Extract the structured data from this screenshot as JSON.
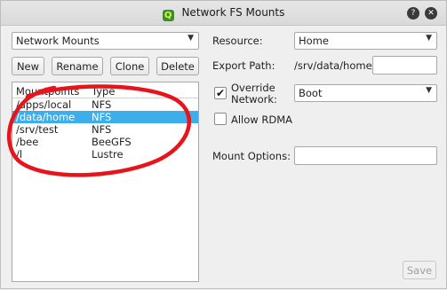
{
  "window": {
    "title": "Network FS Mounts",
    "app_icon_glyph": "Q",
    "help_glyph": "?",
    "close_glyph": "✕"
  },
  "mount_selector": {
    "value": "Network Mounts"
  },
  "toolbar": {
    "new_label": "New",
    "rename_label": "Rename",
    "clone_label": "Clone",
    "delete_label": "Delete"
  },
  "list": {
    "columns": [
      "Mountpoints",
      "Type"
    ],
    "rows": [
      {
        "mountpoint": "/apps/local",
        "type": "NFS"
      },
      {
        "mountpoint": "/data/home",
        "type": "NFS"
      },
      {
        "mountpoint": "/srv/test",
        "type": "NFS"
      },
      {
        "mountpoint": "/bee",
        "type": "BeeGFS"
      },
      {
        "mountpoint": "/l",
        "type": "Lustre"
      }
    ],
    "selected_index": 1
  },
  "form": {
    "resource_label": "Resource:",
    "resource_value": "Home",
    "export_path_label": "Export Path:",
    "export_path_prefix": "/srv/data/home/",
    "export_path_value": "",
    "override_network_label_1": "Override",
    "override_network_label_2": "Network:",
    "override_network_checked": true,
    "network_value": "Boot",
    "allow_rdma_label": "Allow RDMA",
    "allow_rdma_checked": false,
    "mount_options_label": "Mount Options:",
    "mount_options_value": ""
  },
  "footer": {
    "save_label": "Save"
  },
  "colors": {
    "selection": "#3daee9",
    "annotation": "#e8141c"
  },
  "icons": [
    "help-icon",
    "close-icon",
    "dropdown-arrow-icon",
    "checkmark-icon",
    "app-icon"
  ]
}
